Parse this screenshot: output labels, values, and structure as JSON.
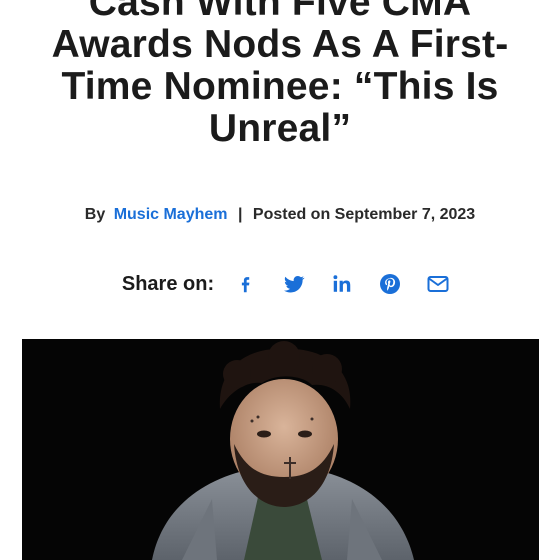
{
  "article": {
    "headline_lines": [
      "Cash With Five CMA",
      "Awards Nods As A First-",
      "Time Nominee: “This Is",
      "Unreal”"
    ],
    "by_label": "By",
    "author": "Music Mayhem",
    "separator": "|",
    "posted_text": "Posted on September 7, 2023"
  },
  "share": {
    "label": "Share on:",
    "icons": [
      "facebook-icon",
      "twitter-icon",
      "linkedin-icon",
      "pinterest-icon",
      "email-icon"
    ],
    "accent_color": "#1a6fd8"
  },
  "hero_image": {
    "description_icon": "portrait-photo"
  }
}
